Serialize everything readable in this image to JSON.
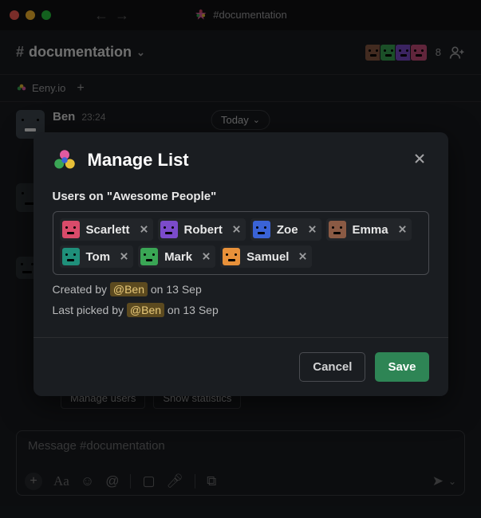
{
  "titlebar": {
    "channel": "#documentation"
  },
  "channel": {
    "hash": "#",
    "name": "documentation"
  },
  "tabs": {
    "app": "Eeny.io"
  },
  "members": {
    "count": "8",
    "avatars": [
      "#8a5a44",
      "#3aa655",
      "#7b4bca",
      "#c94f7c"
    ]
  },
  "message": {
    "user": "Ben",
    "time": "23:24"
  },
  "today": "Today",
  "modal": {
    "title": "Manage List",
    "list_label": "Users on \"Awesome People\"",
    "users": [
      {
        "name": "Scarlett",
        "color": "#d94b6a"
      },
      {
        "name": "Robert",
        "color": "#7b4bca"
      },
      {
        "name": "Zoe",
        "color": "#3a63d6"
      },
      {
        "name": "Emma",
        "color": "#8a5a44"
      },
      {
        "name": "Tom",
        "color": "#1f8f7a"
      },
      {
        "name": "Mark",
        "color": "#3aa655"
      },
      {
        "name": "Samuel",
        "color": "#e8913a"
      }
    ],
    "created_pre": "Created by ",
    "created_mention": "@Ben",
    "created_post": " on 13 Sep",
    "picked_pre": "Last picked by ",
    "picked_mention": "@Ben",
    "picked_post": " on 13 Sep",
    "cancel": "Cancel",
    "save": "Save"
  },
  "actions": {
    "manage": "Manage users",
    "stats": "Show statistics"
  },
  "composer": {
    "placeholder": "Message #documentation"
  }
}
